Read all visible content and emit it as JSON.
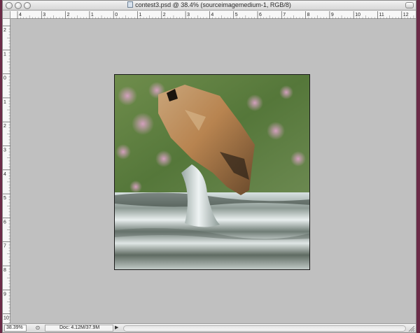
{
  "window": {
    "title": "contest3.psd @ 38.4% (sourceimagemedium-1, RGB/8)"
  },
  "rulers": {
    "horizontal_labels": [
      "4",
      "3",
      "2",
      "1",
      "0",
      "1",
      "2",
      "3",
      "4",
      "5",
      "6",
      "7",
      "8",
      "9",
      "10",
      "11",
      "12"
    ],
    "vertical_labels": [
      "2",
      "1",
      "0",
      "1",
      "2",
      "3",
      "4",
      "5",
      "6",
      "7",
      "8",
      "9",
      "10"
    ]
  },
  "status_bar": {
    "zoom": "38.39%",
    "doc_info": "Doc: 4.12M/37.9M"
  },
  "colors": {
    "desktop": "#7a2f4f",
    "canvas_background": "#c0c0c0"
  }
}
